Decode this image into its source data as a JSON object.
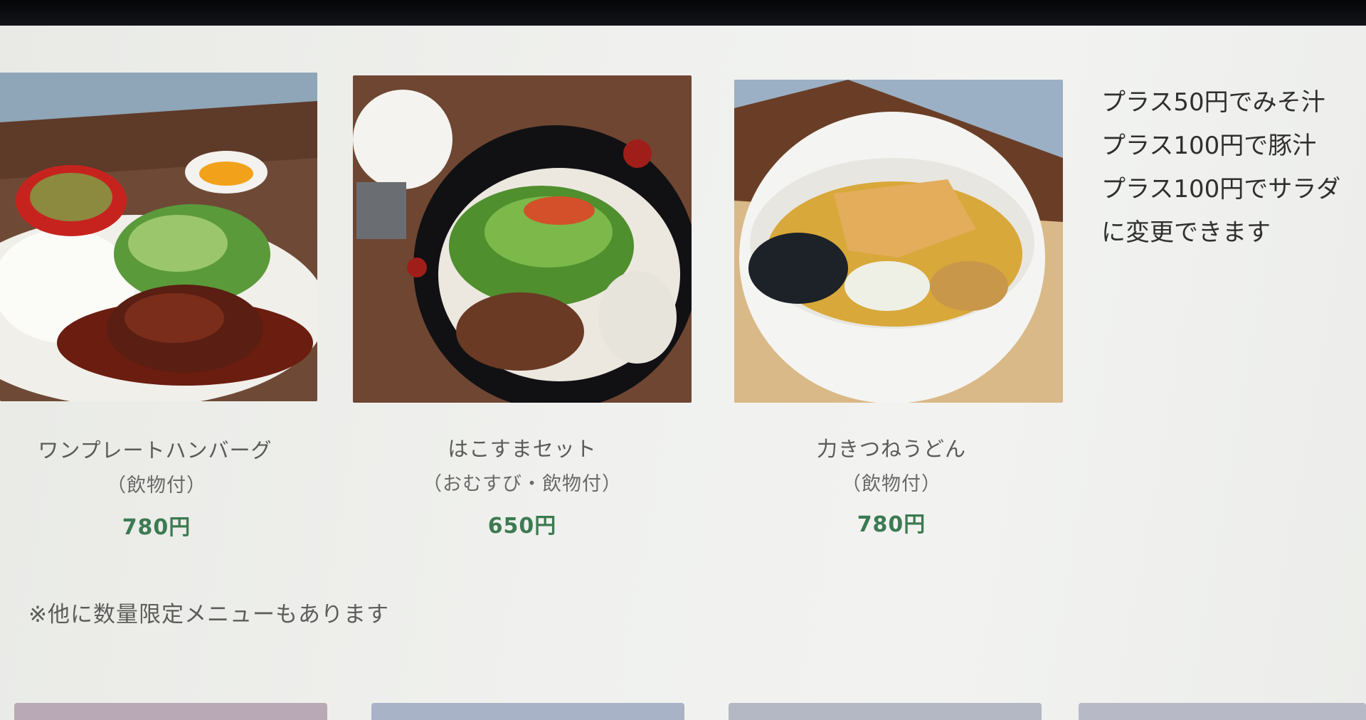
{
  "menu_items": [
    {
      "name": "ワンプレートハンバーグ",
      "note": "（飲物付）",
      "price": "780円",
      "photo": "hamburg-steak-plate"
    },
    {
      "name": "はこすまセット",
      "note": "（おむすび・飲物付）",
      "price": "650円",
      "photo": "udon-bowl-with-rice-ball"
    },
    {
      "name": "力きつねうどん",
      "note": "（飲物付）",
      "price": "780円",
      "photo": "kitsune-udon-bowl"
    }
  ],
  "side_note": {
    "line1": "プラス50円でみそ汁",
    "line2": "プラス100円で豚汁",
    "line3": "プラス100円でサラダ",
    "line4": "に変更できます"
  },
  "footnote": "※他に数量限定メニューもあります",
  "colors": {
    "price": "#3d7a52",
    "text": "#5a5a58",
    "background": "#eeefec"
  }
}
